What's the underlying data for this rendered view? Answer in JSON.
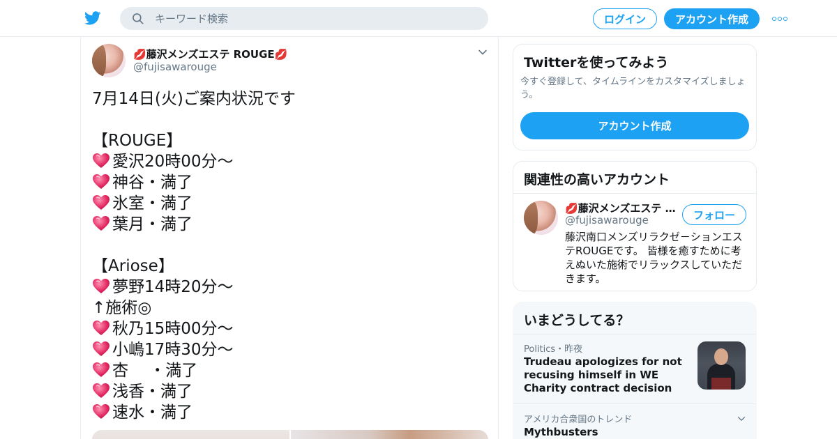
{
  "header": {
    "search_placeholder": "キーワード検索",
    "login_label": "ログイン",
    "signup_label": "アカウント作成"
  },
  "tweet": {
    "author_name": "💋藤沢メンズエステ ROUGE💋",
    "author_handle": "@fujisawarouge",
    "lines": [
      {
        "heart": false,
        "text": "7月14日(火)ご案内状況です"
      },
      {
        "heart": false,
        "text": ""
      },
      {
        "heart": false,
        "text": "【ROUGE】"
      },
      {
        "heart": true,
        "text": "愛沢20時00分～"
      },
      {
        "heart": true,
        "text": "神谷・満了"
      },
      {
        "heart": true,
        "text": "氷室・満了"
      },
      {
        "heart": true,
        "text": "葉月・満了"
      },
      {
        "heart": false,
        "text": ""
      },
      {
        "heart": false,
        "text": "【Ariose】"
      },
      {
        "heart": true,
        "text": "夢野14時20分～"
      },
      {
        "heart": false,
        "text": "↑施術◎"
      },
      {
        "heart": true,
        "text": "秋乃15時00分～"
      },
      {
        "heart": true,
        "text": "小嶋17時30分～"
      },
      {
        "heart": true,
        "text": "杏　  ・満了"
      },
      {
        "heart": true,
        "text": "浅香・満了"
      },
      {
        "heart": true,
        "text": "速水・満了"
      }
    ]
  },
  "signup_card": {
    "title": "Twitterを使ってみよう",
    "description": "今すぐ登録して、タイムラインをカスタマイズしましょう。",
    "button_label": "アカウント作成"
  },
  "related_card": {
    "title": "関連性の高いアカウント",
    "account_name": "💋藤沢メンズエステ ROUGE💋",
    "account_handle": "@fujisawarouge",
    "follow_label": "フォロー",
    "bio": "藤沢南口メンズリラクゼ－ションエステROUGEです。 皆様を癒すために考えぬいた施術でリラックスしていただきます。"
  },
  "trends_card": {
    "title": "いまどうしてる？",
    "item1_meta": "Politics・昨夜",
    "item1_headline": "Trudeau apologizes for not recusing himself in WE Charity contract decision",
    "item2_meta": "アメリカ合衆国のトレンド",
    "item2_trend": "Mythbusters"
  },
  "colors": {
    "accent": "#1da1f2",
    "text": "#14171a",
    "secondary": "#657786",
    "border": "#e6ecf0",
    "heart": "#e0245e"
  },
  "icons": [
    "twitter-bird-icon",
    "search-icon",
    "more-icon",
    "chevron-down-icon",
    "heart-icon",
    "lips-icon"
  ]
}
